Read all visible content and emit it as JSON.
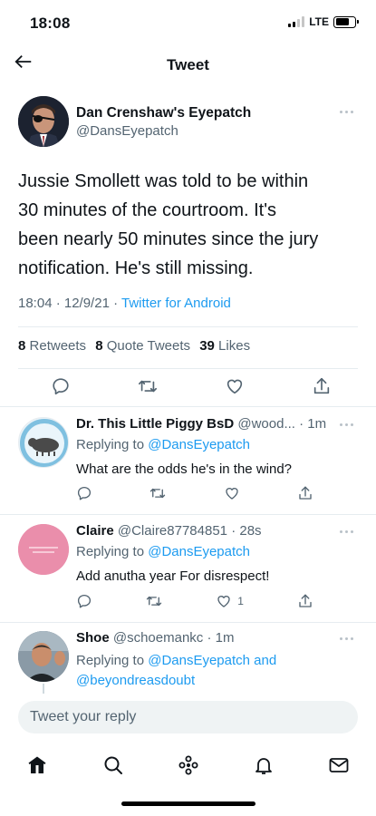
{
  "status": {
    "time": "18:08",
    "network": "LTE"
  },
  "header": {
    "title": "Tweet"
  },
  "tweet": {
    "author_name": "Dan Crenshaw's Eyepatch",
    "author_handle": "@DansEyepatch",
    "text_lines": [
      "Jussie Smollett was told to be within",
      "30 minutes of the courtroom. It's",
      "been nearly 50 minutes since the jury",
      "notification. He's still missing."
    ],
    "time": "18:04 · 12/9/21 · ",
    "source": "Twitter for Android",
    "retweets": "8",
    "retweets_label": "Retweets",
    "quotes": "8",
    "quotes_label": "Quote Tweets",
    "likes": "39",
    "likes_label": "Likes"
  },
  "replies": [
    {
      "name": "Dr. This Little Piggy BsD",
      "handle": "@wood...",
      "time": "· 1m",
      "replying_prefix": "Replying to ",
      "replying_to": "@DansEyepatch",
      "text": "What are the odds he's in the wind?",
      "like_count": ""
    },
    {
      "name": "Claire",
      "handle": "@Claire87784851",
      "time": "· 28s",
      "replying_prefix": "Replying to ",
      "replying_to": "@DansEyepatch",
      "text": "Add anutha year For disrespect!",
      "like_count": "1"
    },
    {
      "name": "Shoe",
      "handle": "@schoemankc",
      "time": "· 1m",
      "replying_prefix": "Replying to ",
      "replying_to": "@DansEyepatch and",
      "replying_to_2": "@beyondreasdoubt"
    }
  ],
  "composer": {
    "placeholder": "Tweet your reply"
  },
  "tabbar": [
    "home-icon",
    "search-icon",
    "spaces-icon",
    "notifications-icon",
    "messages-icon"
  ],
  "colors": {
    "accent": "#1d9bf0",
    "secondary_text": "#536471",
    "divider": "#e6ecf0"
  }
}
